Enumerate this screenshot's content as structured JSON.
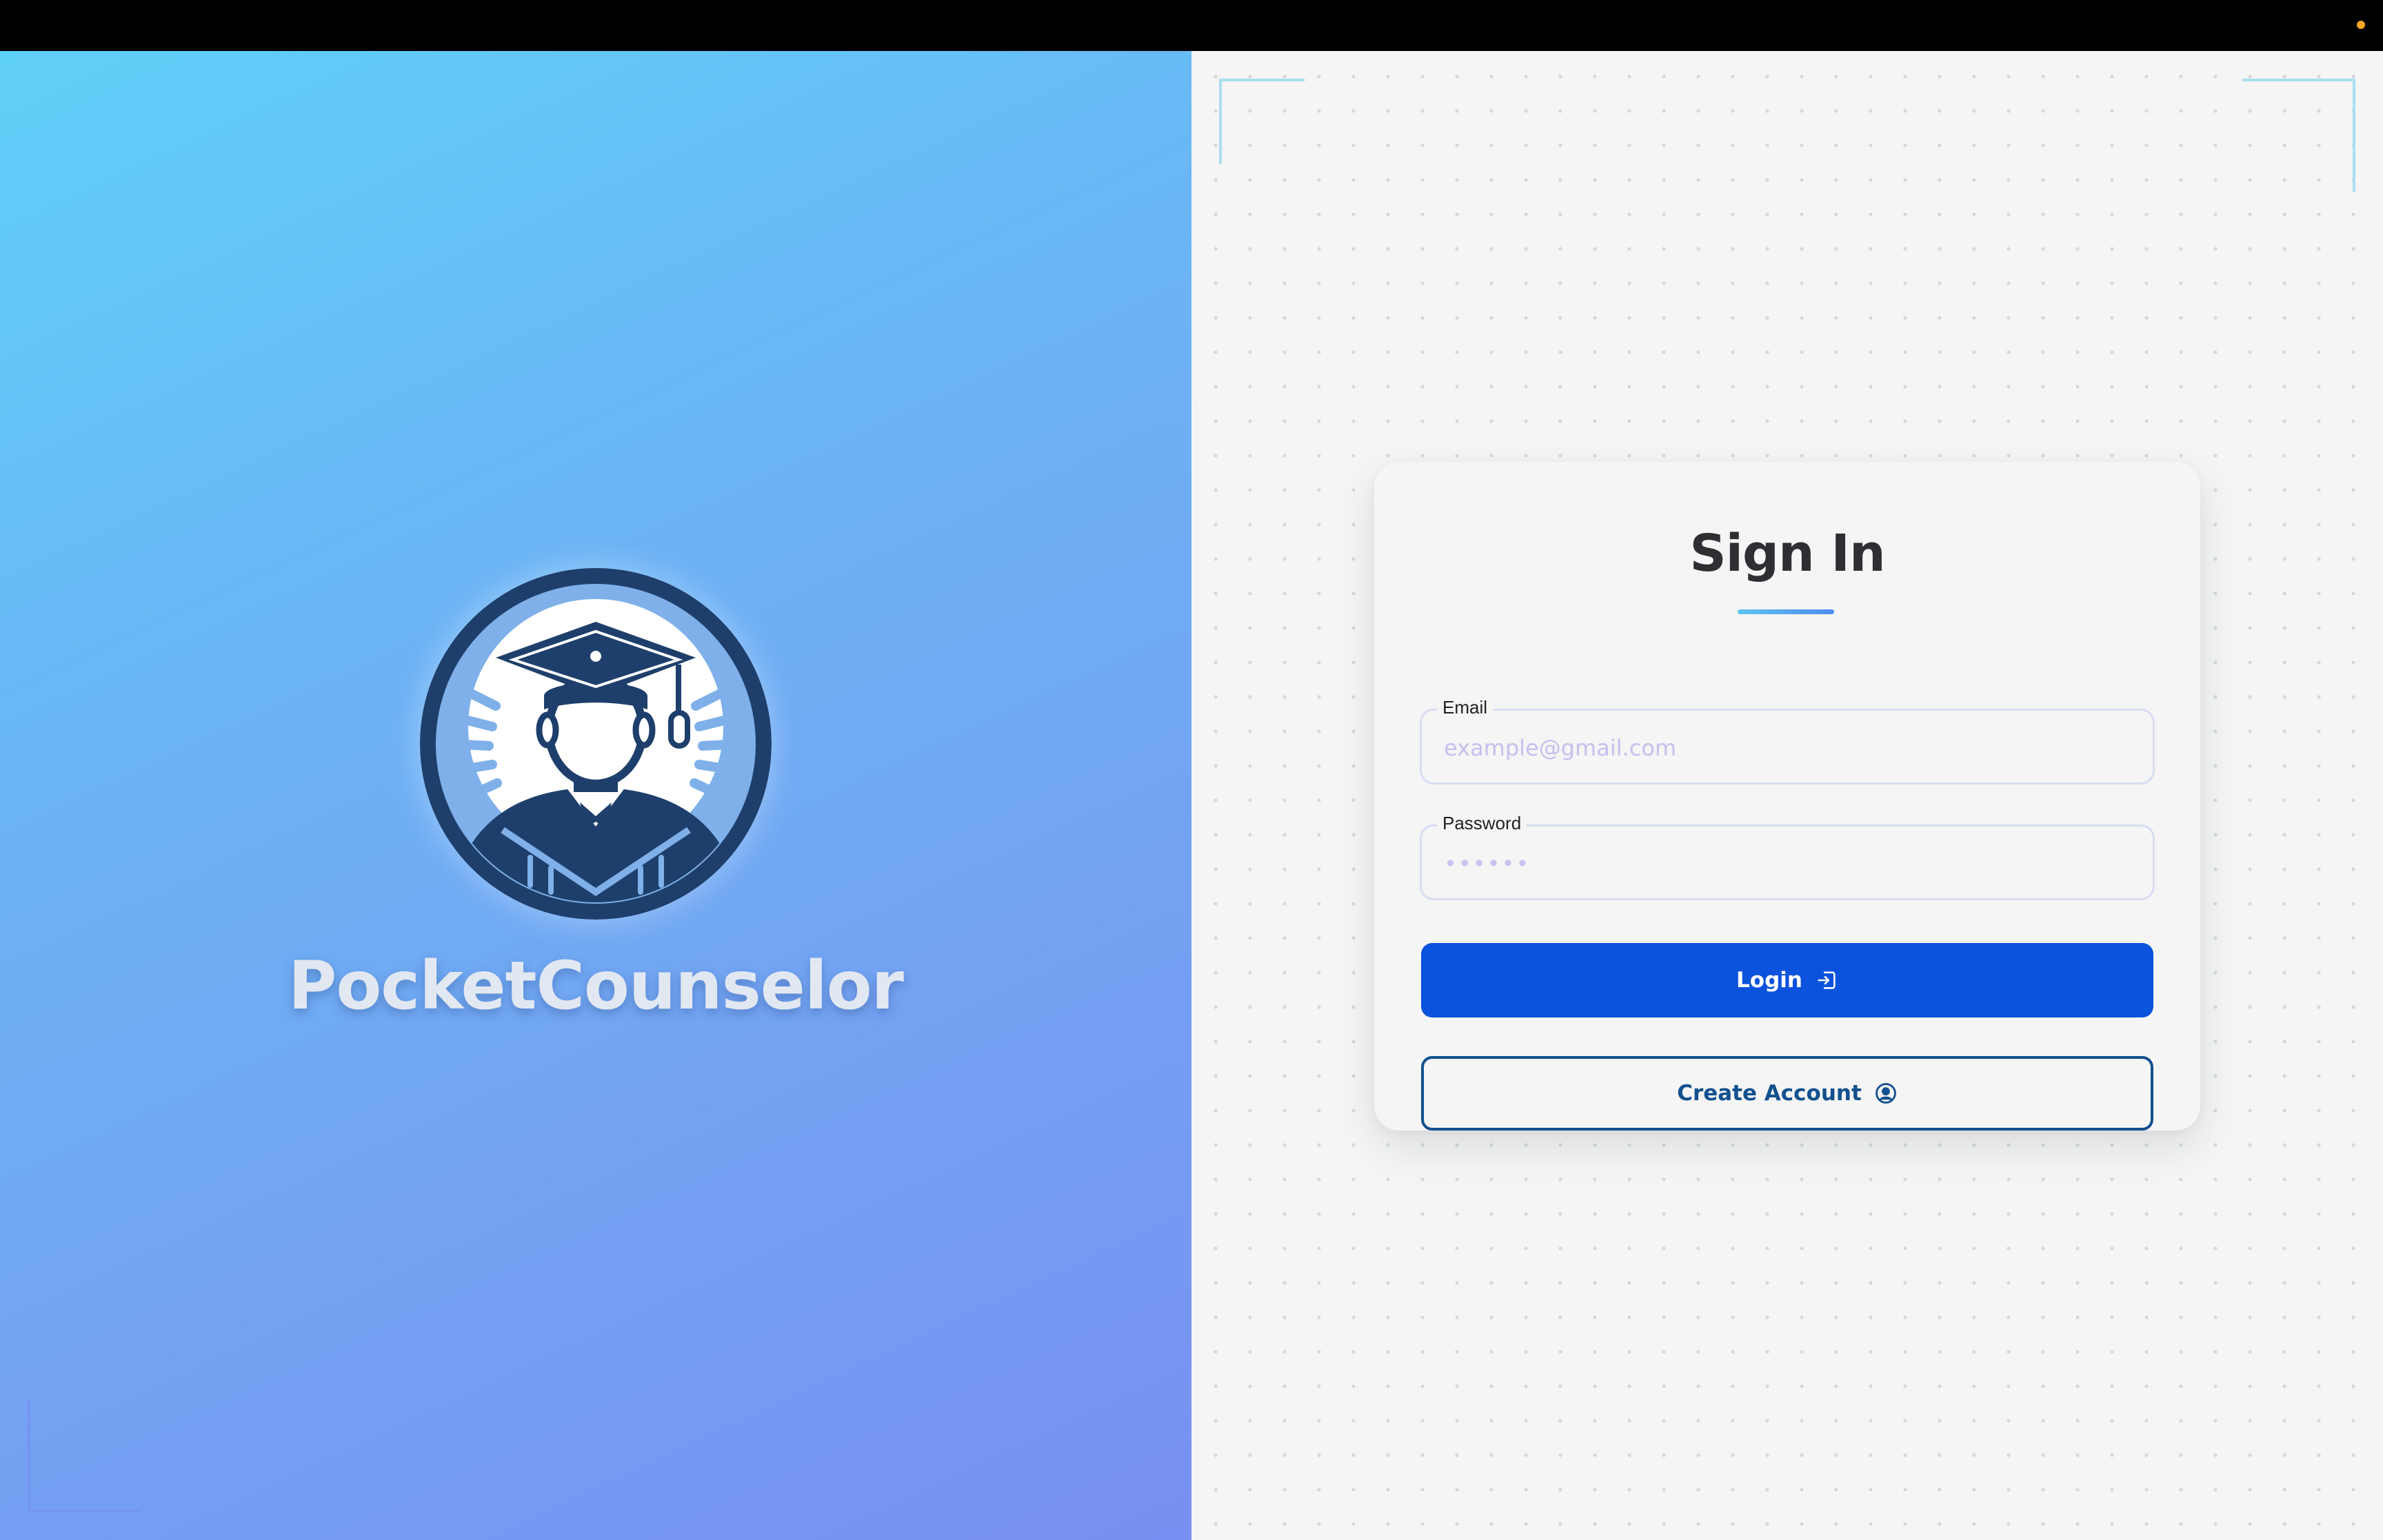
{
  "colors": {
    "top_bar": "#000000",
    "indicator_dot": "#f5a623",
    "left_gradient_start": "#5fd0f7",
    "left_gradient_end": "#7890f1",
    "login_button": "#0b52dd",
    "create_account_border": "#12508f"
  },
  "brand": {
    "name": "PocketCounselor",
    "logo_icon": "graduate-icon"
  },
  "signin": {
    "title": "Sign In",
    "email": {
      "label": "Email",
      "placeholder": "example@gmail.com",
      "value": ""
    },
    "password": {
      "label": "Password",
      "placeholder": "••••••",
      "value": ""
    },
    "login_button": {
      "label": "Login",
      "icon": "login-icon"
    },
    "create_account_button": {
      "label": "Create Account",
      "icon": "user-circle-icon"
    }
  }
}
